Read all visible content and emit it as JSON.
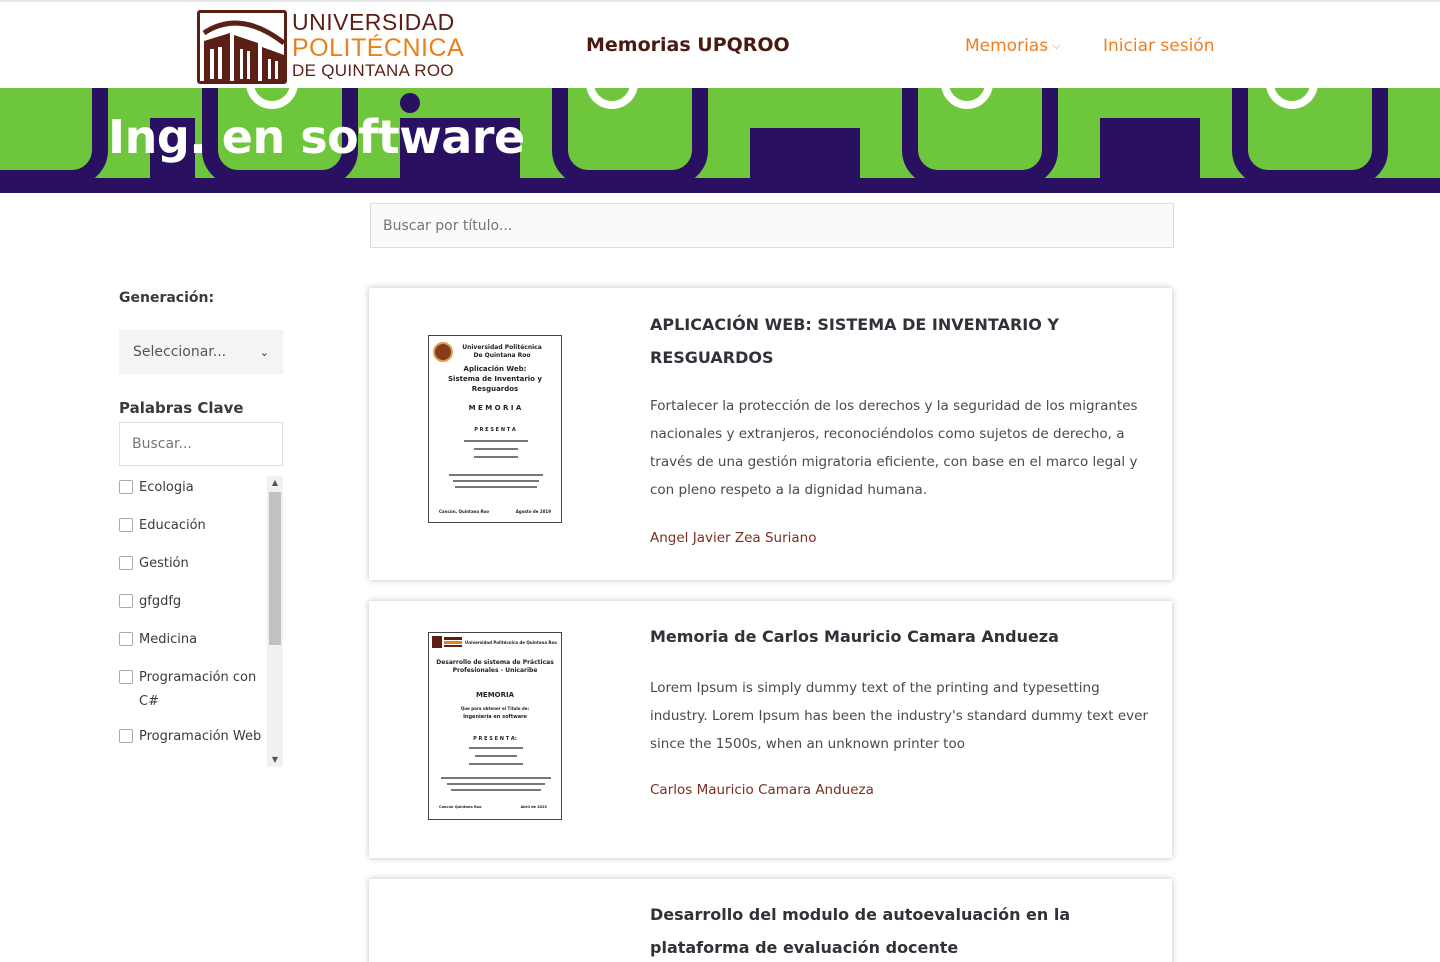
{
  "header": {
    "logo": {
      "line1": "UNIVERSIDAD",
      "line2": "POLITÉCNICA",
      "line3": "DE QUINTANA ROO"
    },
    "site_title": "Memorias UPQROO",
    "nav": {
      "memorias": "Memorias",
      "login": "Iniciar sesión"
    },
    "colors": {
      "brand_brown": "#5b1f16",
      "brand_orange": "#f07e1f"
    }
  },
  "banner": {
    "title": "Ing. en software",
    "colors": {
      "green": "#6dc63b",
      "purple": "#2a1060"
    }
  },
  "search": {
    "placeholder": "Buscar por título..."
  },
  "sidebar": {
    "generation_label": "Generación:",
    "generation_select": "Seleccionar...",
    "keywords_label": "Palabras Clave",
    "keywords_placeholder": "Buscar...",
    "keywords": [
      {
        "label": "Ecologia"
      },
      {
        "label": "Educación"
      },
      {
        "label": "Gestión"
      },
      {
        "label": "gfgdfg"
      },
      {
        "label": "Medicina"
      },
      {
        "label": "Programación con C#"
      },
      {
        "label": "Programación Web"
      }
    ]
  },
  "cards": [
    {
      "title": "APLICACIÓN WEB: SISTEMA DE INVENTARIO Y RESGUARDOS",
      "description": "Fortalecer la protección de los derechos y la seguridad de los migrantes nacionales y extranjeros, reconociéndolos como sujetos de derecho, a través de una gestión migratoria eficiente, con base en el marco legal y con pleno respeto a la dignidad humana.",
      "author": "Angel Javier Zea Suriano",
      "thumb": {
        "l1": "Universidad Politécnica",
        "l2": "De Quintana Roo",
        "l3": "Aplicación Web:",
        "l4": "Sistema de Inventario y",
        "l5": "Resguardos",
        "l6": "M E M O R I A",
        "l7": "P R E S E N T A",
        "l8": "Cancún, Quintana Roo",
        "l9": "Agosto de 2019"
      }
    },
    {
      "title": "Memoria de Carlos Mauricio Camara Andueza",
      "description": "Lorem Ipsum is simply dummy text of the printing and typesetting industry. Lorem Ipsum has been the industry's standard dummy text ever since the 1500s, when an unknown printer too",
      "author": "Carlos Mauricio Camara Andueza",
      "thumb": {
        "l1": "Universidad Politécnica de Quintana Roo",
        "l2": "Desarrollo de sistema de Prácticas",
        "l3": "Profesionales - Unicaribe",
        "l4": "MEMORIA",
        "l5": "Que para obtener el Título de:",
        "l6": "Ingeniería en software",
        "l7": "P R E S E N T A:",
        "l8": "Cancún Quintana Roo",
        "l9": "Abril de 2023"
      }
    },
    {
      "title": "Desarrollo del modulo de autoevaluación en la plataforma de evaluación docente"
    }
  ]
}
